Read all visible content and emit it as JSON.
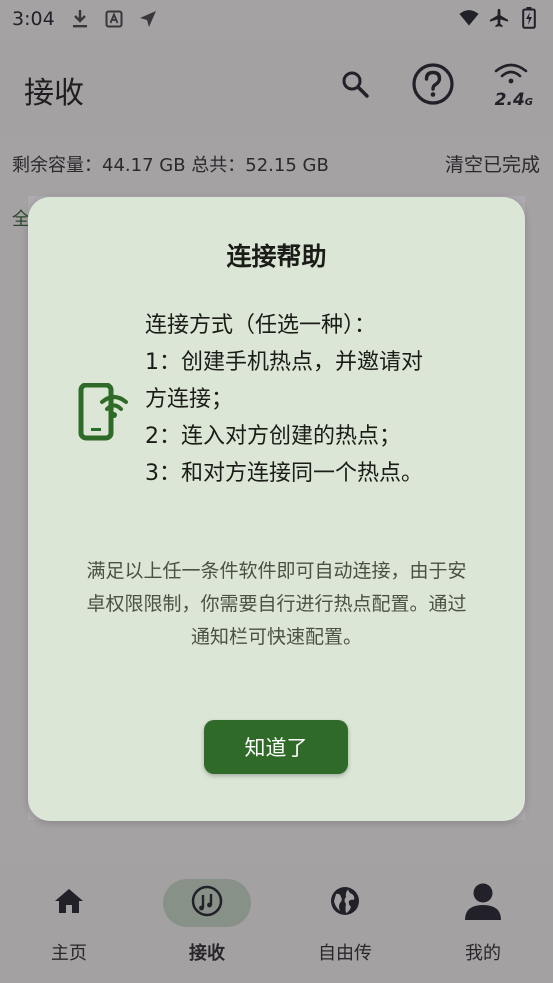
{
  "status_bar": {
    "time": "3:04",
    "left_icons": [
      "download-icon",
      "a-box-icon",
      "send-arrow-icon"
    ],
    "right_icons": [
      "wifi-icon",
      "airplane-icon",
      "battery-charging-icon"
    ]
  },
  "app_bar": {
    "title": "接收",
    "band_label": "2.4",
    "band_suffix": "G"
  },
  "storage": {
    "info": "剩余容量：44.17 GB 总共：52.15 GB",
    "clear_label": "清空已完成",
    "filter_partial": "全"
  },
  "dialog": {
    "title": "连接帮助",
    "methods": [
      "连接方式（任选一种）：",
      "1：创建手机热点，并邀请对",
      "方连接；",
      "2：连入对方创建的热点；",
      "3：和对方连接同一个热点。"
    ],
    "note": "满足以上任一条件软件即可自动连接，由于安卓权限限制，你需要自行进行热点配置。通过通知栏可快速配置。",
    "ok_label": "知道了"
  },
  "bottom_nav": {
    "items": [
      {
        "label": "主页",
        "icon": "home-icon",
        "active": false
      },
      {
        "label": "接收",
        "icon": "vinyl-icon",
        "active": true
      },
      {
        "label": "自由传",
        "icon": "globe-icon",
        "active": false
      },
      {
        "label": "我的",
        "icon": "person-icon",
        "active": false
      }
    ]
  },
  "colors": {
    "accent": "#2f6a28",
    "dialog_bg": "#dbe6d6",
    "nav_active_pill": "#c3d7bd"
  }
}
